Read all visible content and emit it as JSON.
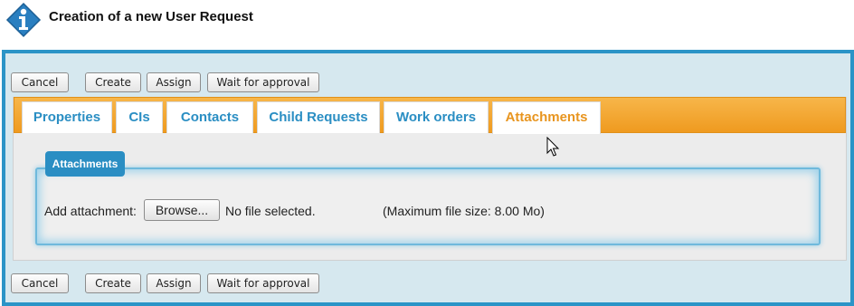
{
  "header": {
    "title": "Creation of a new User Request",
    "icon": "info-icon"
  },
  "toolbar": {
    "cancel": "Cancel",
    "create": "Create",
    "assign": "Assign",
    "wait": "Wait for approval"
  },
  "tabs": [
    {
      "label": "Properties",
      "active": false
    },
    {
      "label": "CIs",
      "active": false
    },
    {
      "label": "Contacts",
      "active": false
    },
    {
      "label": "Child Requests",
      "active": false
    },
    {
      "label": "Work orders",
      "active": false
    },
    {
      "label": "Attachments",
      "active": true
    }
  ],
  "attachments": {
    "legend": "Attachments",
    "add_label": "Add attachment:",
    "browse_label": "Browse...",
    "file_status": "No file selected.",
    "max_size_note": "(Maximum file size: 8.00 Mo)"
  },
  "colors": {
    "frame_border": "#2b94c7",
    "tab_strip": "#ef9a1f",
    "tab_text": "#2a8ec3",
    "tab_active_text": "#e8951f",
    "legend_bg": "#2a8ec3"
  }
}
